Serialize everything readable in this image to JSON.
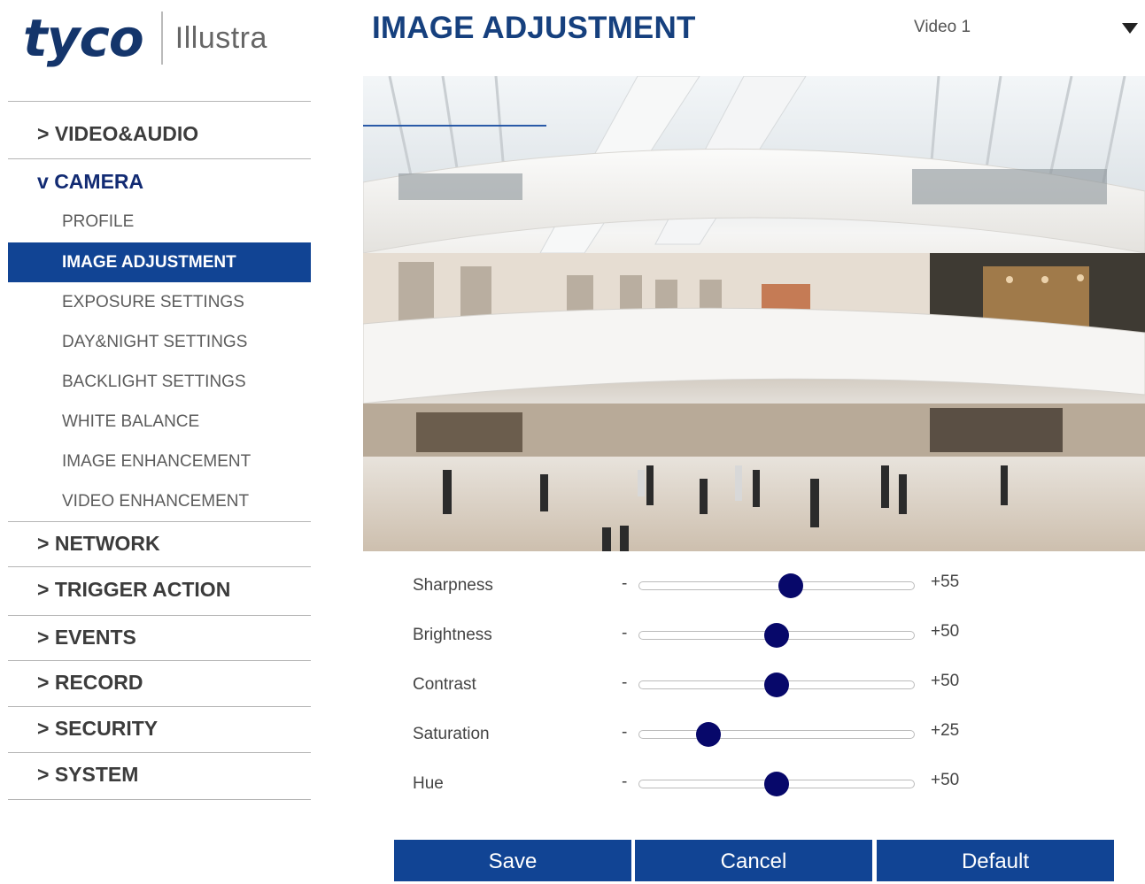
{
  "logo": {
    "brand": "tyco",
    "product": "Illustra"
  },
  "header": {
    "title": "IMAGE ADJUSTMENT",
    "video_select": "Video 1"
  },
  "sidebar": {
    "sections": [
      {
        "prefix": ">",
        "label": "VIDEO&AUDIO"
      },
      {
        "prefix": "v",
        "label": "CAMERA"
      },
      {
        "prefix": ">",
        "label": "NETWORK"
      },
      {
        "prefix": ">",
        "label": "TRIGGER ACTION"
      },
      {
        "prefix": ">",
        "label": "EVENTS"
      },
      {
        "prefix": ">",
        "label": "RECORD"
      },
      {
        "prefix": ">",
        "label": "SECURITY"
      },
      {
        "prefix": ">",
        "label": "SYSTEM"
      }
    ],
    "camera_items": [
      "PROFILE",
      "IMAGE ADJUSTMENT",
      "EXPOSURE SETTINGS",
      "DAY&NIGHT SETTINGS",
      "BACKLIGHT SETTINGS",
      "WHITE BALANCE",
      "IMAGE ENHANCEMENT",
      "VIDEO ENHANCEMENT"
    ]
  },
  "sliders": [
    {
      "label": "Sharpness",
      "minus": "-",
      "value": 55,
      "display": "+55"
    },
    {
      "label": "Brightness",
      "minus": "-",
      "value": 50,
      "display": "+50"
    },
    {
      "label": "Contrast",
      "minus": "-",
      "value": 50,
      "display": "+50"
    },
    {
      "label": "Saturation",
      "minus": "-",
      "value": 25,
      "display": "+25"
    },
    {
      "label": "Hue",
      "minus": "-",
      "value": 50,
      "display": "+50"
    }
  ],
  "buttons": {
    "save": "Save",
    "cancel": "Cancel",
    "default": "Default"
  },
  "colors": {
    "accent": "#114494",
    "title": "#16407e",
    "thumb": "#07086a"
  }
}
